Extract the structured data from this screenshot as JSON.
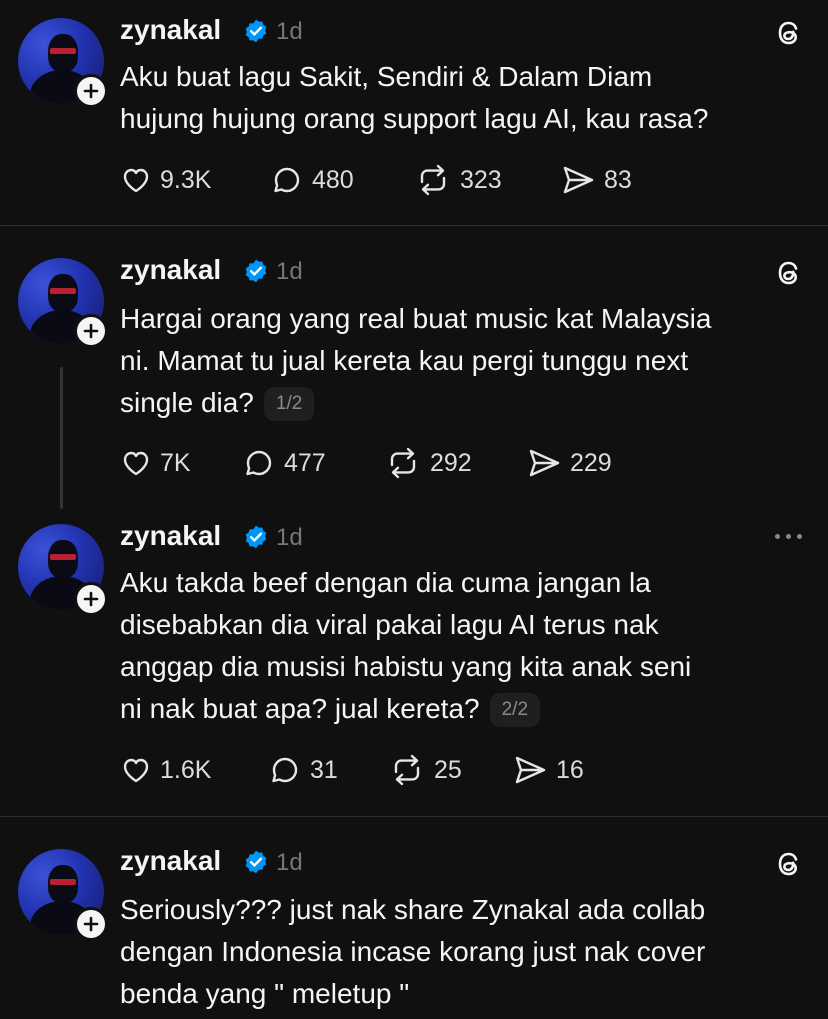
{
  "posts": [
    {
      "username": "zynakal",
      "time": "1d",
      "corner_icon": "threads-logo-icon",
      "lines": [
        "Aku buat lagu Sakit, Sendiri & Dalam Diam",
        "hujung hujung orang support lagu AI, kau rasa?"
      ],
      "pager": "",
      "likes": "9.3K",
      "replies": "480",
      "reposts": "323",
      "shares": "83"
    },
    {
      "username": "zynakal",
      "time": "1d",
      "corner_icon": "threads-logo-icon",
      "lines": [
        "Hargai orang yang real buat music kat Malaysia",
        "ni. Mamat tu jual kereta kau pergi tunggu next",
        "single dia?"
      ],
      "pager": "1/2",
      "likes": "7K",
      "replies": "477",
      "reposts": "292",
      "shares": "229"
    },
    {
      "username": "zynakal",
      "time": "1d",
      "corner_icon": "more-options-icon",
      "lines": [
        "Aku takda beef dengan dia cuma jangan la",
        "disebabkan dia viral pakai lagu AI terus nak",
        "anggap dia musisi habistu yang kita anak seni",
        "ni nak buat apa? jual kereta?"
      ],
      "pager": "2/2",
      "likes": "1.6K",
      "replies": "31",
      "reposts": "25",
      "shares": "16"
    },
    {
      "username": "zynakal",
      "time": "1d",
      "corner_icon": "threads-logo-icon",
      "lines": [
        "Seriously??? just nak share Zynakal ada collab",
        "dengan Indonesia incase korang just nak cover",
        "benda yang \" meletup \""
      ],
      "pager": ""
    }
  ],
  "colors": {
    "background": "#101010",
    "text": "#f3f5f7",
    "muted": "#777777",
    "verified": "#0095f6",
    "divider": "#2b2b2b"
  }
}
